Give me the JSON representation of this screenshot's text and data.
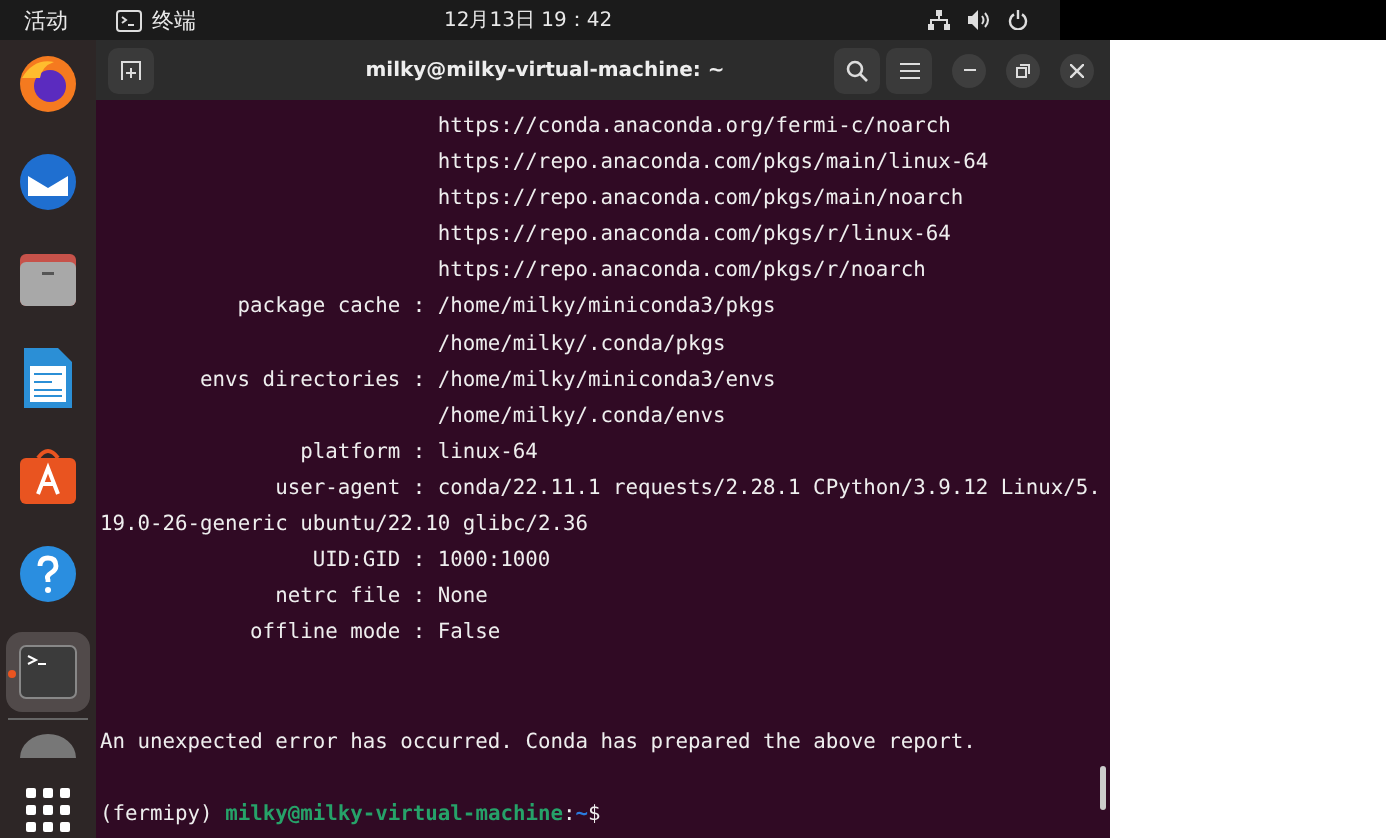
{
  "top_bar": {
    "activities": "活动",
    "app_name": "终端",
    "clock": "12月13日  19：42"
  },
  "dock": {
    "items": [
      {
        "kind": "firefox",
        "active": false
      },
      {
        "kind": "mail",
        "active": false
      },
      {
        "kind": "files",
        "active": false
      },
      {
        "kind": "writer",
        "active": false
      },
      {
        "kind": "store",
        "active": false
      },
      {
        "kind": "help",
        "active": false
      },
      {
        "kind": "terminal",
        "active": true
      },
      {
        "kind": "disk",
        "active": false
      }
    ]
  },
  "window": {
    "title": "milky@milky-virtual-machine: ~"
  },
  "terminal": {
    "lines": [
      {
        "kind": "cont",
        "value": "https://conda.anaconda.org/fermi-c/noarch"
      },
      {
        "kind": "cont",
        "value": "https://repo.anaconda.com/pkgs/main/linux-64"
      },
      {
        "kind": "cont",
        "value": "https://repo.anaconda.com/pkgs/main/noarch"
      },
      {
        "kind": "cont",
        "value": "https://repo.anaconda.com/pkgs/r/linux-64"
      },
      {
        "kind": "cont",
        "value": "https://repo.anaconda.com/pkgs/r/noarch"
      },
      {
        "kind": "entry",
        "key": "package cache",
        "separator": ":",
        "value": "/home/milky/miniconda3/pkgs"
      },
      {
        "kind": "cont",
        "value": "/home/milky/.conda/pkgs"
      },
      {
        "kind": "entry",
        "key": "envs directories",
        "separator": ":",
        "value": "/home/milky/miniconda3/envs"
      },
      {
        "kind": "cont",
        "value": "/home/milky/.conda/envs"
      },
      {
        "kind": "entry",
        "key": "platform",
        "separator": ":",
        "value": "linux-64"
      },
      {
        "kind": "entry",
        "key": "user-agent",
        "separator": ":",
        "value": "conda/22.11.1 requests/2.28.1 CPython/3.9.12 Linux/5."
      },
      {
        "kind": "plain",
        "value": "19.0-26-generic ubuntu/22.10 glibc/2.36"
      },
      {
        "kind": "entry",
        "key": "UID:GID",
        "separator": ":",
        "value": "1000:1000"
      },
      {
        "kind": "entry",
        "key": "netrc file",
        "separator": ":",
        "value": "None"
      },
      {
        "kind": "entry",
        "key": "offline mode",
        "separator": ":",
        "value": "False"
      },
      {
        "kind": "blank"
      },
      {
        "kind": "blank"
      },
      {
        "kind": "plain",
        "value": "An unexpected error has occurred. Conda has prepared the above report."
      },
      {
        "kind": "blank"
      }
    ],
    "prompt": {
      "env": "(fermipy)",
      "user_host": "milky@milky-virtual-machine",
      "separator": ":",
      "path": "~",
      "symbol": "$"
    }
  }
}
